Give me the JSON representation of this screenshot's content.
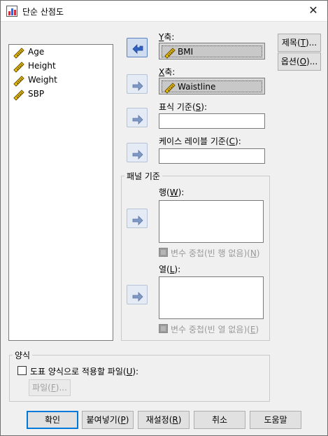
{
  "window": {
    "title": "단순 산점도",
    "close_glyph": "✕",
    "icon": "spss-chart-icon"
  },
  "variables": [
    {
      "name": "Age",
      "icon": "scale-ruler-icon"
    },
    {
      "name": "Height",
      "icon": "scale-ruler-icon"
    },
    {
      "name": "Weight",
      "icon": "scale-ruler-icon"
    },
    {
      "name": "SBP",
      "icon": "scale-ruler-icon"
    }
  ],
  "y_axis": {
    "label": "축:",
    "mnemonic": "Y",
    "value": "BMI"
  },
  "x_axis": {
    "label": "축:",
    "mnemonic": "X",
    "value": "Waistline"
  },
  "marker": {
    "label_pre": "표식 기준(",
    "mnemonic": "S",
    "label_post": "):",
    "value": ""
  },
  "case_label": {
    "label_pre": "케이스 레이블 기준(",
    "mnemonic": "C",
    "label_post": "):",
    "value": ""
  },
  "panel": {
    "title": "패널 기준",
    "rows_label_pre": "행(",
    "rows_mnemonic": "W",
    "rows_label_post": "):",
    "rows_nest_pre": "변수 중첩(빈 행 없음)(",
    "rows_nest_mnemonic": "N",
    "rows_nest_post": ")",
    "cols_label_pre": "열(",
    "cols_mnemonic": "L",
    "cols_label_post": "):",
    "cols_nest_pre": "변수 중첩(빈 열 없음)(",
    "cols_nest_mnemonic": "E",
    "cols_nest_post": ")"
  },
  "side_buttons": {
    "titles_pre": "제목(",
    "titles_mn": "T",
    "titles_post": ")...",
    "options_pre": "옵션(",
    "options_mn": "O",
    "options_post": ")..."
  },
  "template": {
    "title": "양식",
    "check_pre": "도표 양식으로 적용할 파일(",
    "check_mn": "U",
    "check_post": "):",
    "file_pre": "파일(",
    "file_mn": "F",
    "file_post": ")..."
  },
  "footer": {
    "ok": "확인",
    "paste_pre": "붙여넣기(",
    "paste_mn": "P",
    "paste_post": ")",
    "reset_pre": "재설정(",
    "reset_mn": "R",
    "reset_post": ")",
    "cancel": "취소",
    "help": "도움말"
  },
  "colors": {
    "accent": "#0078d7",
    "arrow_active": "#3a6fc6",
    "arrow_inactive": "#8aa2c8"
  }
}
